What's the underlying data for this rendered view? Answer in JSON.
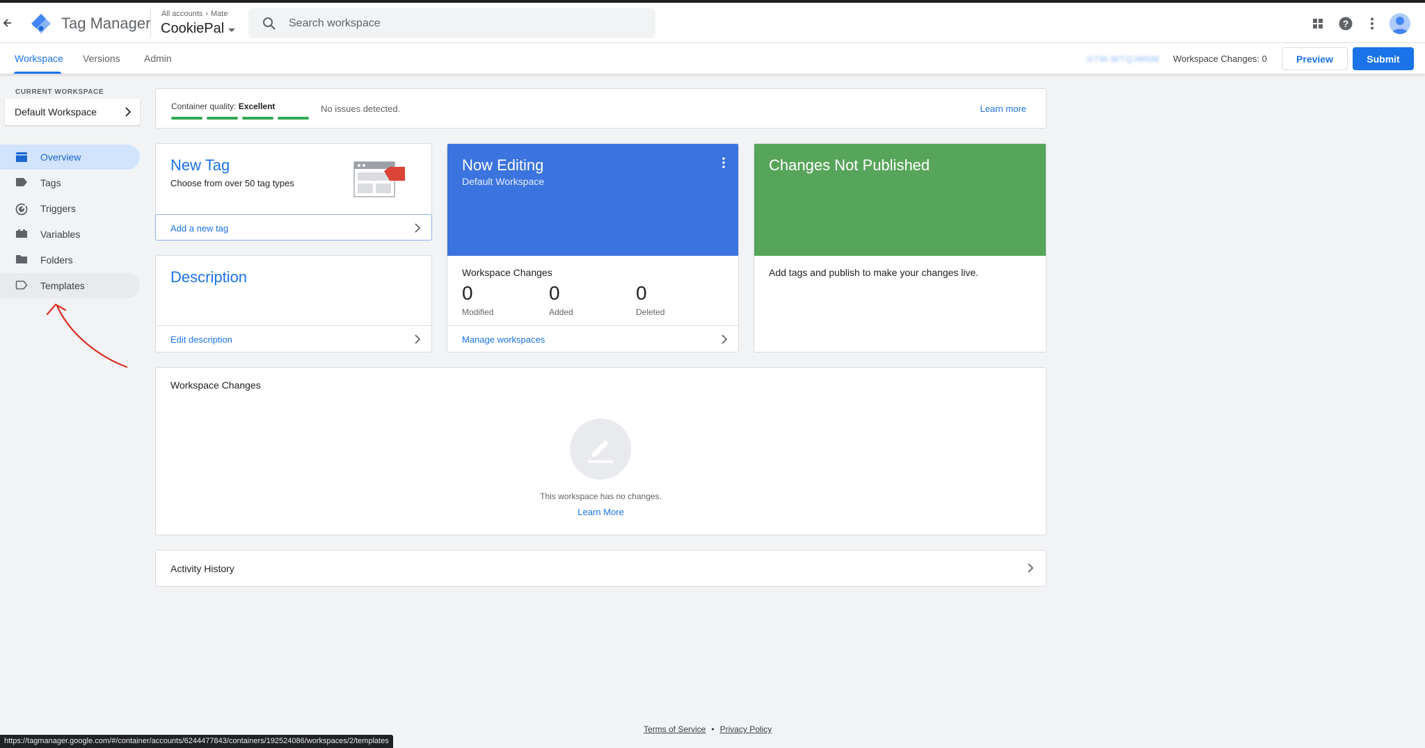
{
  "app": {
    "title": "Tag Manager"
  },
  "header": {
    "breadcrumb": [
      "All accounts",
      "Mate"
    ],
    "container_name": "CookiePal",
    "search_placeholder": "Search workspace"
  },
  "tabs": [
    {
      "label": "Workspace",
      "active": true
    },
    {
      "label": "Versions",
      "active": false
    },
    {
      "label": "Admin",
      "active": false
    }
  ],
  "topbar_right": {
    "container_id": "GTM-WTQJMNM",
    "workspace_changes": "Workspace Changes: 0",
    "preview_label": "Preview",
    "submit_label": "Submit"
  },
  "sidebar": {
    "current_workspace_label": "CURRENT WORKSPACE",
    "workspace_name": "Default Workspace",
    "items": [
      {
        "label": "Overview",
        "icon": "overview-icon",
        "active": true
      },
      {
        "label": "Tags",
        "icon": "tag-icon",
        "active": false
      },
      {
        "label": "Triggers",
        "icon": "trigger-icon",
        "active": false
      },
      {
        "label": "Variables",
        "icon": "variable-icon",
        "active": false
      },
      {
        "label": "Folders",
        "icon": "folder-icon",
        "active": false
      },
      {
        "label": "Templates",
        "icon": "template-icon",
        "active": false,
        "hover": true
      }
    ]
  },
  "quality": {
    "label": "Container quality:",
    "value": "Excellent",
    "segments_filled": 4,
    "segments_total": 4,
    "issues": "No issues detected.",
    "learn_more": "Learn more"
  },
  "new_tag": {
    "title": "New Tag",
    "subtitle": "Choose from over 50 tag types",
    "action": "Add a new tag"
  },
  "description": {
    "title": "Description",
    "action": "Edit description"
  },
  "now_editing": {
    "title": "Now Editing",
    "workspace": "Default Workspace",
    "changes_title": "Workspace Changes",
    "stats": [
      {
        "value": "0",
        "label": "Modified"
      },
      {
        "value": "0",
        "label": "Added"
      },
      {
        "value": "0",
        "label": "Deleted"
      }
    ],
    "action": "Manage workspaces"
  },
  "not_published": {
    "title": "Changes Not Published",
    "message": "Add tags and publish to make your changes live."
  },
  "workspace_changes": {
    "title": "Workspace Changes",
    "empty_text": "This workspace has no changes.",
    "learn_more": "Learn More"
  },
  "activity": {
    "title": "Activity History"
  },
  "footer": {
    "terms": "Terms of Service",
    "separator": "•",
    "privacy": "Privacy Policy"
  },
  "status_url": "https://tagmanager.google.com/#/container/accounts/6244477843/containers/192524086/workspaces/2/templates",
  "colors": {
    "accent": "#1a73e8",
    "editing_card": "#3b73df",
    "published_card": "#57a55a",
    "quality_bar": "#34a853",
    "annotation_arrow": "#d93025"
  }
}
